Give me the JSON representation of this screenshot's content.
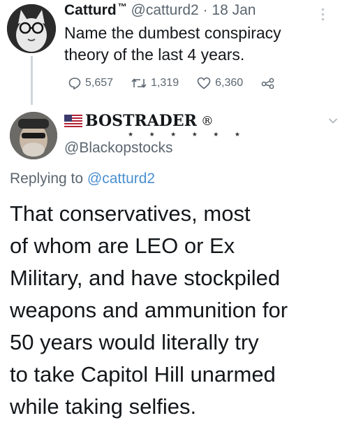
{
  "tweet1": {
    "display_name": "Catturd",
    "trademark": "™",
    "handle": "@catturd2",
    "separator": "·",
    "date": "18 Jan",
    "text": "Name the dumbest conspiracy theory of the last 4 years.",
    "replies": "5,657",
    "retweets": "1,319",
    "likes": "6,360"
  },
  "tweet2": {
    "display_name": "BOSTRADER",
    "registered_mark": "®",
    "name_decoration": "★ ★ ★ ★ ★ ★",
    "handle": "@Blackopstocks",
    "replying_prefix": "Replying to",
    "replying_to": "@catturd2",
    "text_lines": [
      "That conservatives, most",
      "of whom are LEO or Ex",
      "Military, and have stockpiled",
      "weapons and ammunition for",
      "50 years would literally try",
      "to take Capitol Hill  unarmed",
      "while taking selfies."
    ]
  },
  "icons": {
    "reply": "reply-icon",
    "retweet": "retweet-icon",
    "like": "heart-icon",
    "share": "share-icon",
    "more": "more-vertical-icon",
    "expand": "chevron-down-icon",
    "flag": "us-flag-icon"
  },
  "colors": {
    "link": "#4a8fd0",
    "muted": "#5b6670",
    "text": "#14171a",
    "thread_line": "#cfd5da"
  }
}
